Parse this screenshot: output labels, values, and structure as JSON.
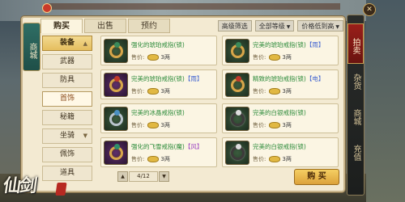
{
  "game": {
    "logo_text": "仙剑"
  },
  "side_tab_label": "商城",
  "tabs": [
    {
      "label": "购买",
      "active": true
    },
    {
      "label": "出售",
      "active": false
    },
    {
      "label": "预约",
      "active": false
    }
  ],
  "filters": {
    "advanced": "高级筛选",
    "level": "全部等级",
    "sort": "价格低到高"
  },
  "categories": [
    {
      "label": "装备",
      "header": true,
      "chevron": "▲"
    },
    {
      "label": "武器"
    },
    {
      "label": "防具"
    },
    {
      "label": "首饰",
      "selected": true
    },
    {
      "label": "秘籍"
    },
    {
      "label": "坐骑",
      "chevron": "▼"
    },
    {
      "label": "佩饰"
    },
    {
      "label": "道具"
    }
  ],
  "items": [
    {
      "name": "强化的琥珀戒指(锁)",
      "tag": "",
      "price_label": "售价:",
      "price": "3两",
      "bg": "green",
      "ring": "gold",
      "gem": "#3a8a5a"
    },
    {
      "name": "完美的琥珀戒指(锁)",
      "tag": "【雨】",
      "price_label": "售价:",
      "price": "3两",
      "bg": "green",
      "ring": "gold",
      "gem": "#3a8a5a"
    },
    {
      "name": "完美的琥珀戒指(锁)",
      "tag": "【雨】",
      "price_label": "售价:",
      "price": "3两",
      "bg": "purple",
      "ring": "gold",
      "gem": "#c0392b"
    },
    {
      "name": "精致的琥珀戒指(锁)",
      "tag": "【电】",
      "price_label": "售价:",
      "price": "3两",
      "bg": "green",
      "ring": "gold",
      "gem": "#c0392b"
    },
    {
      "name": "完美的冰晶戒指(锁)",
      "tag": "",
      "price_label": "售价:",
      "price": "3两",
      "bg": "green",
      "ring": "silver",
      "gem": "#4a90c2"
    },
    {
      "name": "完美的白银戒指(锁)",
      "tag": "",
      "price_label": "售价:",
      "price": "3两",
      "bg": "green",
      "ring": "dark",
      "gem": "#dddddd"
    },
    {
      "name": "强化的飞雪戒指(魔)",
      "tag": "【风】",
      "price_label": "售价:",
      "price": "3两",
      "bg": "purple",
      "ring": "gold",
      "gem": "#2f8f6a"
    },
    {
      "name": "完美的白银戒指(锁)",
      "tag": "",
      "price_label": "售价:",
      "price": "3两",
      "bg": "green",
      "ring": "dark",
      "gem": "#dddddd"
    }
  ],
  "pager": {
    "prev": "▲",
    "page": "4/12",
    "next": "▼"
  },
  "buy_label": "购 买",
  "right_nav": [
    {
      "label": "拍卖",
      "active": true
    },
    {
      "label": "杂货"
    },
    {
      "label": "商城"
    },
    {
      "label": "充值"
    }
  ],
  "close_label": "✕"
}
